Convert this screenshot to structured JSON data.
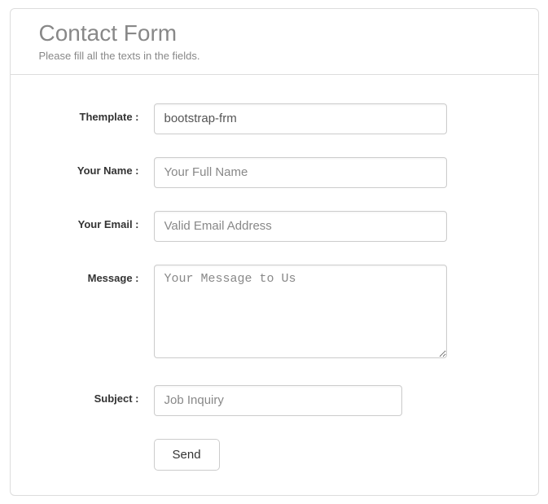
{
  "header": {
    "title": "Contact Form",
    "subtitle": "Please fill all the texts in the fields."
  },
  "form": {
    "template": {
      "label": "Themplate :",
      "value": "bootstrap-frm"
    },
    "name": {
      "label": "Your Name :",
      "placeholder": "Your Full Name",
      "value": ""
    },
    "email": {
      "label": "Your Email :",
      "placeholder": "Valid Email Address",
      "value": ""
    },
    "message": {
      "label": "Message :",
      "placeholder": "Your Message to Us",
      "value": ""
    },
    "subject": {
      "label": "Subject :",
      "selected": "Job Inquiry"
    },
    "submit_label": "Send"
  }
}
